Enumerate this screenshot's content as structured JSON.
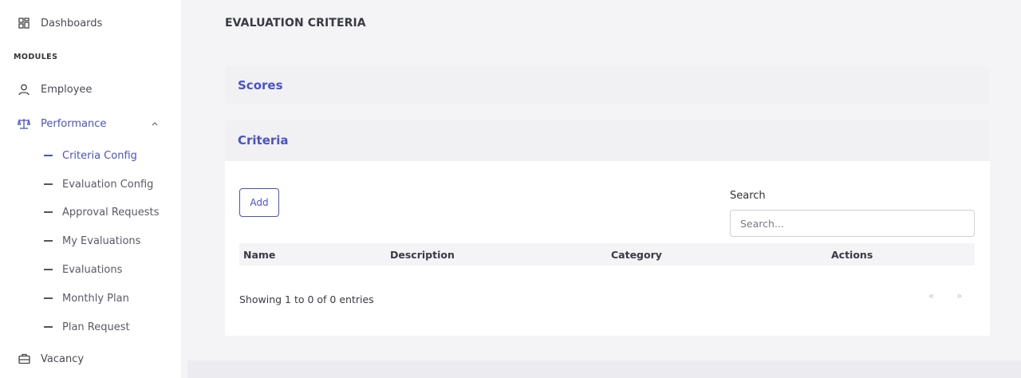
{
  "sidebar": {
    "dashboards": {
      "label": "Dashboards",
      "icon": "grid-icon"
    },
    "section_label": "MODULES",
    "employee": {
      "label": "Employee",
      "icon": "user-icon"
    },
    "performance": {
      "label": "Performance",
      "icon": "scale-icon",
      "expanded": true
    },
    "sub_items": [
      {
        "label": "Criteria Config",
        "active": true
      },
      {
        "label": "Evaluation Config"
      },
      {
        "label": "Approval Requests"
      },
      {
        "label": "My Evaluations"
      },
      {
        "label": "Evaluations"
      },
      {
        "label": "Monthly Plan"
      },
      {
        "label": "Plan Request"
      }
    ],
    "vacancy": {
      "label": "Vacancy",
      "icon": "briefcase-icon"
    }
  },
  "main": {
    "title": "EVALUATION CRITERIA",
    "panels": [
      {
        "title": "Scores"
      },
      {
        "title": "Criteria"
      }
    ],
    "add_label": "Add",
    "search": {
      "label": "Search",
      "placeholder": "Search..."
    },
    "table": {
      "columns": [
        "Name",
        "Description",
        "Category",
        "Actions"
      ],
      "rows": []
    },
    "info": "Showing 1 to 0 of 0 entries",
    "pager": {
      "prev": "«",
      "next": "»"
    }
  },
  "colors": {
    "accent": "#4a52c9",
    "background": "#f4f4f6",
    "panel_head": "#f1f1f4"
  }
}
